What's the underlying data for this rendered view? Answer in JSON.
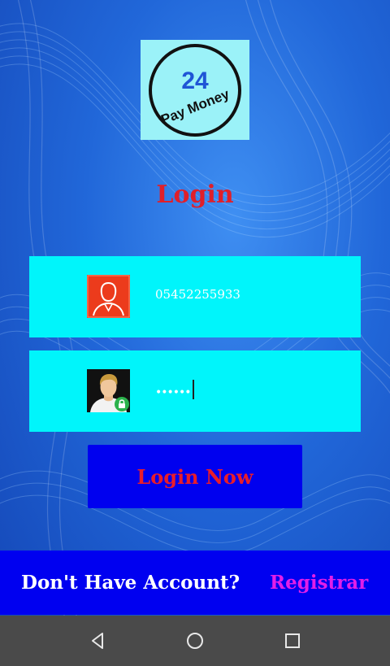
{
  "logo": {
    "number": "24",
    "text": "Pay Money"
  },
  "login": {
    "title": "Login",
    "phone_value": "05452255933",
    "password_value": "••••••",
    "button_label": "Login Now"
  },
  "footer": {
    "question": "Don't Have Account?",
    "register_label": "Registrar"
  },
  "icons": {
    "phone_field": "user-icon",
    "password_field": "user-lock-icon",
    "nav_back": "back-icon",
    "nav_home": "home-icon",
    "nav_recent": "recent-apps-icon"
  },
  "colors": {
    "accent_red": "#e01f2a",
    "field_cyan": "#00f5fb",
    "button_blue": "#0000ef",
    "register_magenta": "#e21ee8"
  }
}
